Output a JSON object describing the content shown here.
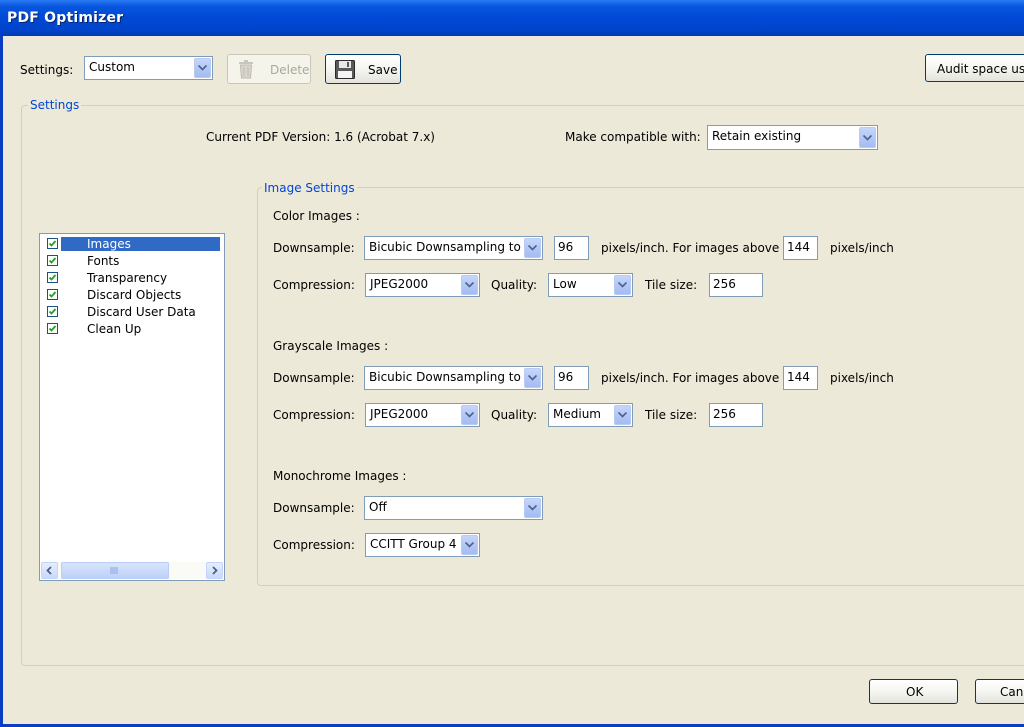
{
  "window": {
    "title": "PDF Optimizer"
  },
  "toolbar": {
    "settings_label": "Settings:",
    "settings_value": "Custom",
    "delete_label": "Delete",
    "save_label": "Save",
    "audit_label": "Audit space usa"
  },
  "settings_group": {
    "title": "Settings",
    "current_version": "Current PDF Version: 1.6 (Acrobat 7.x)",
    "compat_label": "Make compatible with:",
    "compat_value": "Retain existing"
  },
  "categories": [
    {
      "label": "Images",
      "checked": true,
      "selected": true
    },
    {
      "label": "Fonts",
      "checked": true,
      "selected": false
    },
    {
      "label": "Transparency",
      "checked": true,
      "selected": false
    },
    {
      "label": "Discard Objects",
      "checked": true,
      "selected": false
    },
    {
      "label": "Discard User Data",
      "checked": true,
      "selected": false
    },
    {
      "label": "Clean Up",
      "checked": true,
      "selected": false
    }
  ],
  "image_settings": {
    "title": "Image Settings",
    "color": {
      "heading": "Color Images :",
      "downsample_label": "Downsample:",
      "downsample_value": "Bicubic Downsampling to",
      "ppi": "96",
      "ppi_text": "pixels/inch. For images above",
      "above": "144",
      "above_unit": "pixels/inch",
      "compression_label": "Compression:",
      "compression_value": "JPEG2000",
      "quality_label": "Quality:",
      "quality_value": "Low",
      "tile_label": "Tile size:",
      "tile_value": "256"
    },
    "grayscale": {
      "heading": "Grayscale Images :",
      "downsample_label": "Downsample:",
      "downsample_value": "Bicubic Downsampling to",
      "ppi": "96",
      "ppi_text": "pixels/inch. For images above",
      "above": "144",
      "above_unit": "pixels/inch",
      "compression_label": "Compression:",
      "compression_value": "JPEG2000",
      "quality_label": "Quality:",
      "quality_value": "Medium",
      "tile_label": "Tile size:",
      "tile_value": "256"
    },
    "mono": {
      "heading": "Monochrome Images :",
      "downsample_label": "Downsample:",
      "downsample_value": "Off",
      "compression_label": "Compression:",
      "compression_value": "CCITT Group 4"
    }
  },
  "footer": {
    "ok_label": "OK",
    "cancel_label": "Canc"
  }
}
